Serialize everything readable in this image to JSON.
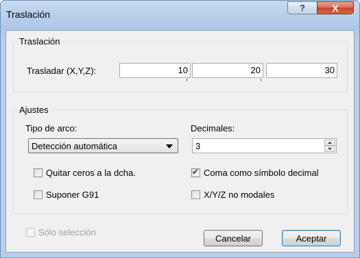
{
  "window": {
    "title": "Traslación",
    "help_glyph": "?",
    "close_glyph": "X"
  },
  "traslacion": {
    "legend": "Traslación",
    "label": "Trasladar (X,Y,Z):",
    "x": "10",
    "y": "20",
    "z": "30",
    "separator": ","
  },
  "ajustes": {
    "legend": "Ajustes",
    "tipo_arco_label": "Tipo de arco:",
    "tipo_arco_value": "Detección automática",
    "decimales_label": "Decimales:",
    "decimales_value": "3",
    "quitar_ceros": {
      "label": "Quitar ceros a la dcha.",
      "checked": false
    },
    "coma_decimal": {
      "label": "Coma como símbolo decimal",
      "checked": true
    },
    "suponer_g91": {
      "label": "Suponer G91",
      "checked": false
    },
    "xyz_no_modales": {
      "label": "X/Y/Z no modales",
      "checked": false
    }
  },
  "footer": {
    "solo_seleccion": {
      "label": "Sólo selección",
      "checked": false,
      "disabled": true
    },
    "cancel_label": "Cancelar",
    "ok_label": "Aceptar"
  }
}
